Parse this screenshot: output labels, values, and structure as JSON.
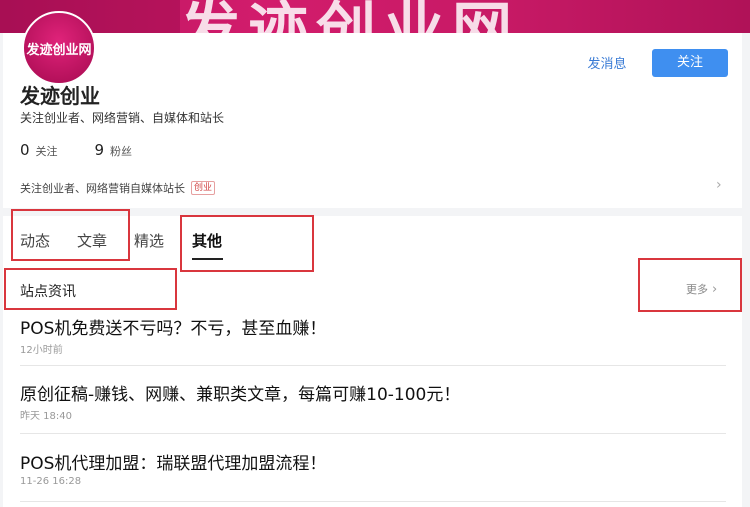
{
  "banner": {
    "text": "发迹创业网"
  },
  "profile": {
    "avatar_text": "发迹创业网",
    "name": "发迹创业",
    "bio": "关注创业者、网络营销、自媒体和站长",
    "following_count": "0",
    "following_label": "关注",
    "fans_count": "9",
    "fans_label": "粉丝",
    "intro": "关注创业者、网络营销自媒体站长",
    "intro_tag": "创业",
    "message_label": "发消息",
    "follow_label": "关注"
  },
  "tabs": [
    {
      "label": "动态"
    },
    {
      "label": "文章"
    },
    {
      "label": "精选"
    },
    {
      "label": "其他"
    }
  ],
  "section": {
    "title": "站点资讯",
    "more_label": "更多"
  },
  "articles": [
    {
      "title": "POS机免费送不亏吗？不亏，甚至血赚！",
      "time": "12小时前"
    },
    {
      "title": "原创征稿-赚钱、网赚、兼职类文章，每篇可赚10-100元！",
      "time": "昨天 18:40"
    },
    {
      "title": "POS机代理加盟：瑞联盟代理加盟流程！",
      "time": "11-26 16:28"
    }
  ],
  "colors": {
    "accent": "#3f8ff0",
    "highlight_box": "#d9363e",
    "banner": "#c81a66"
  }
}
